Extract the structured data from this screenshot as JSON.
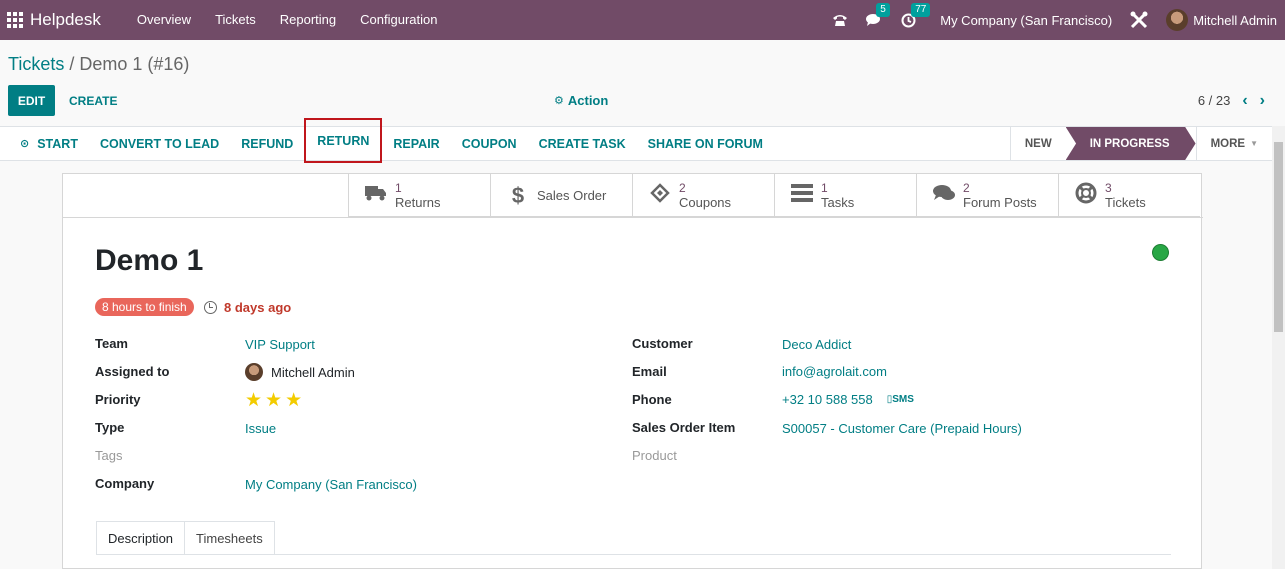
{
  "navbar": {
    "app_name": "Helpdesk",
    "menu": [
      "Overview",
      "Tickets",
      "Reporting",
      "Configuration"
    ],
    "messages_count": "5",
    "activities_count": "77",
    "company": "My Company (San Francisco)",
    "user": "Mitchell Admin",
    "brand_color": "#714b67"
  },
  "breadcrumb": {
    "parent": "Tickets",
    "separator": " / ",
    "current": "Demo 1 (#16)"
  },
  "control": {
    "edit_label": "EDIT",
    "create_label": "CREATE",
    "action_label": "Action",
    "pager": "6 / 23"
  },
  "statusbar": {
    "buttons": [
      "START",
      "CONVERT TO LEAD",
      "REFUND",
      "RETURN",
      "REPAIR",
      "COUPON",
      "CREATE TASK",
      "SHARE ON FORUM"
    ],
    "highlighted": "RETURN",
    "stages": [
      "NEW",
      "IN PROGRESS",
      "MORE"
    ],
    "active_stage": "IN PROGRESS"
  },
  "smart_buttons": [
    {
      "icon": "truck-icon",
      "value": "1",
      "label": "Returns"
    },
    {
      "icon": "dollar-icon",
      "value": "",
      "label": "Sales Order"
    },
    {
      "icon": "ticket-icon",
      "value": "2",
      "label": "Coupons"
    },
    {
      "icon": "tasks-icon",
      "value": "1",
      "label": "Tasks"
    },
    {
      "icon": "comments-icon",
      "value": "2",
      "label": "Forum Posts"
    },
    {
      "icon": "lifebuoy-icon",
      "value": "3",
      "label": "Tickets"
    }
  ],
  "ticket": {
    "title": "Demo 1",
    "sla": "8 hours to finish",
    "deadline": "8 days ago",
    "left_fields": {
      "team_label": "Team",
      "team": "VIP Support",
      "assigned_label": "Assigned to",
      "assigned": "Mitchell Admin",
      "priority_label": "Priority",
      "priority_stars": 3,
      "type_label": "Type",
      "type": "Issue",
      "tags_label": "Tags",
      "company_label": "Company",
      "company": "My Company (San Francisco)"
    },
    "right_fields": {
      "customer_label": "Customer",
      "customer": "Deco Addict",
      "email_label": "Email",
      "email": "info@agrolait.com",
      "phone_label": "Phone",
      "phone": "+32 10 588 558",
      "sms": "SMS",
      "so_item_label": "Sales Order Item",
      "so_item": "S00057 - Customer Care (Prepaid Hours)",
      "product_label": "Product"
    }
  },
  "tabs": [
    "Description",
    "Timesheets"
  ]
}
